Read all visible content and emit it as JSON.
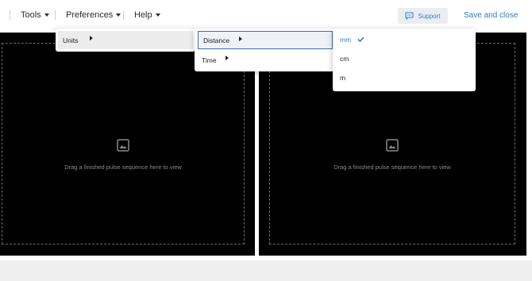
{
  "menubar": {
    "tools_label": "Tools",
    "preferences_label": "Preferences",
    "help_label": "Help"
  },
  "header": {
    "support_label": "Support",
    "support_icon": "chat-icon",
    "save_close_label": "Save and close"
  },
  "viewers": [
    {
      "placeholder": "Drag a finished pulse sequence here to view",
      "icon": "image-icon"
    },
    {
      "placeholder": "Drag a finished pulse sequence here to view",
      "icon": "image-icon"
    }
  ],
  "menus": {
    "preferences": {
      "items": [
        {
          "label": "Units"
        }
      ]
    },
    "units": {
      "items": [
        {
          "label": "Distance"
        },
        {
          "label": "Time"
        }
      ]
    },
    "distance": {
      "items": [
        {
          "label": "mm",
          "selected": true
        },
        {
          "label": "cm",
          "selected": false
        },
        {
          "label": "m",
          "selected": false
        }
      ]
    }
  },
  "colors": {
    "accent": "#2f7ac2",
    "viewer_bg": "#000000",
    "support_bg": "#e9eef3"
  }
}
